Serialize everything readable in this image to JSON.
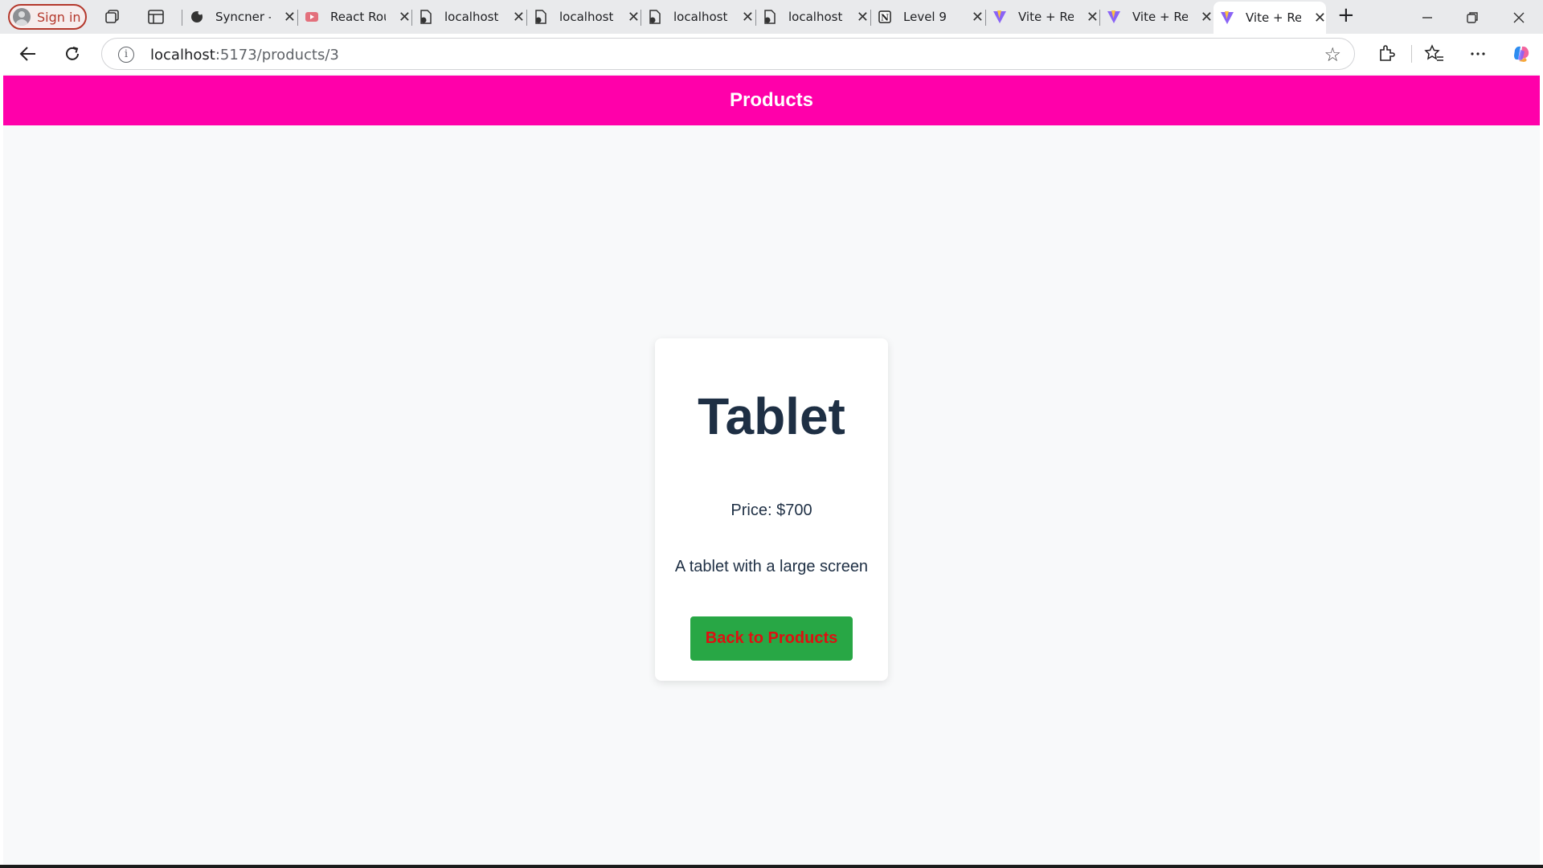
{
  "browser": {
    "signin_label": "Sign in",
    "tabs": [
      {
        "title": "Syncner -",
        "icon": "github-icon"
      },
      {
        "title": "React Rou",
        "icon": "youtube-icon"
      },
      {
        "title": "localhost",
        "icon": "document-icon"
      },
      {
        "title": "localhost",
        "icon": "document-icon"
      },
      {
        "title": "localhost",
        "icon": "document-icon"
      },
      {
        "title": "localhost",
        "icon": "document-icon"
      },
      {
        "title": "Level 9",
        "icon": "notion-icon"
      },
      {
        "title": "Vite + Re",
        "icon": "vite-icon"
      },
      {
        "title": "Vite + Re",
        "icon": "vite-icon"
      },
      {
        "title": "Vite + Re",
        "icon": "vite-icon",
        "active": true
      }
    ],
    "tab_close_glyph": "✕",
    "new_tab_glyph": "+",
    "address": {
      "host": "localhost",
      "path": ":5173/products/3"
    },
    "colors": {
      "accent_signin": "#b4382c",
      "chrome_bg": "#e9eaec"
    }
  },
  "app": {
    "navbar_title": "Products",
    "navbar_color": "#ff00aa",
    "product": {
      "name": "Tablet",
      "price": "Price: $700",
      "description": "A tablet with a large screen"
    },
    "back_button_label": "Back to Products",
    "back_button_color": "#28a745"
  }
}
